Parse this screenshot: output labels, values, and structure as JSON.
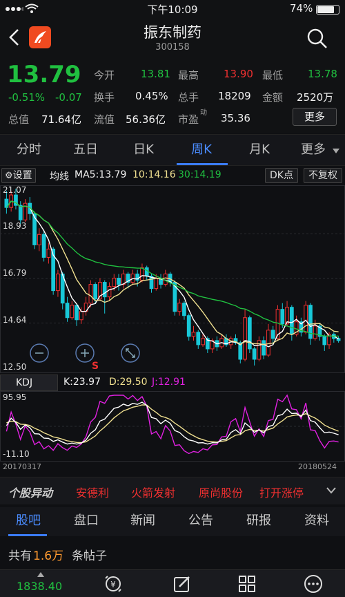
{
  "status_bar": {
    "time": "下午10:09",
    "battery": "74%"
  },
  "header": {
    "title": "振东制药",
    "code": "300158"
  },
  "quote": {
    "price": "13.79",
    "change_pct": "-0.51%",
    "change": "-0.07",
    "open_label": "今开",
    "open": "13.81",
    "high_label": "最高",
    "high": "13.90",
    "low_label": "最低",
    "low": "13.78",
    "turnover_label": "换手",
    "turnover": "0.45%",
    "volume_label": "总手",
    "volume": "18209",
    "amount_label": "金额",
    "amount": "2520万",
    "total_value_label": "总值",
    "total_value": "71.64亿",
    "float_value_label": "流值",
    "float_value": "56.36亿",
    "pe_label": "市盈",
    "pe_sup": "动",
    "pe": "35.36",
    "more": "更多"
  },
  "tabs": [
    "分时",
    "五日",
    "日K",
    "周K",
    "月K",
    "更多"
  ],
  "active_tab": "周K",
  "toolbar": {
    "settings": "设置",
    "ma_label": "均线",
    "ma5": "MA5:13.79",
    "ma10": "10:14.16",
    "ma30": "30:14.19",
    "dk": "DK点",
    "fuquan": "不复权"
  },
  "colors": {
    "up": "#f03030",
    "down": "#18c8d8",
    "ma5": "#ffffff",
    "ma10": "#f0e090",
    "ma30": "#20c040",
    "j": "#e020e0",
    "accent": "#3b7cff"
  },
  "chart_data": {
    "type": "candlestick",
    "y_ticks": [
      "21.07",
      "18.93",
      "16.79",
      "14.64",
      "12.50"
    ],
    "ylim": [
      12.5,
      21.07
    ],
    "x_start": "20170317",
    "x_end": "20180524",
    "candles": [
      [
        20.6,
        20.2,
        21.0,
        19.9
      ],
      [
        20.2,
        20.8,
        21.0,
        20.0
      ],
      [
        20.8,
        20.3,
        21.1,
        20.1
      ],
      [
        20.3,
        19.6,
        20.5,
        19.4
      ],
      [
        19.6,
        20.4,
        20.6,
        19.5
      ],
      [
        20.4,
        19.9,
        20.7,
        19.6
      ],
      [
        19.9,
        18.4,
        20.0,
        18.2
      ],
      [
        18.4,
        18.9,
        19.2,
        18.1
      ],
      [
        18.9,
        17.8,
        19.1,
        17.6
      ],
      [
        17.8,
        18.2,
        18.5,
        17.5
      ],
      [
        18.2,
        16.2,
        18.3,
        16.0
      ],
      [
        16.2,
        17.0,
        17.2,
        15.9
      ],
      [
        17.0,
        15.6,
        17.1,
        15.3
      ],
      [
        15.6,
        14.9,
        15.9,
        14.7
      ],
      [
        14.9,
        15.5,
        15.7,
        14.8
      ],
      [
        15.5,
        14.8,
        15.6,
        14.5
      ],
      [
        14.8,
        15.2,
        15.4,
        14.6
      ],
      [
        15.2,
        15.6,
        15.9,
        15.0
      ],
      [
        15.6,
        16.5,
        16.7,
        15.4
      ],
      [
        16.5,
        15.8,
        16.6,
        15.6
      ],
      [
        15.8,
        16.6,
        16.8,
        15.7
      ],
      [
        16.6,
        15.9,
        16.7,
        15.1
      ],
      [
        15.9,
        16.4,
        16.6,
        15.7
      ],
      [
        16.4,
        16.8,
        17.0,
        16.2
      ],
      [
        16.8,
        16.5,
        17.0,
        16.2
      ],
      [
        16.5,
        17.0,
        17.2,
        16.3
      ],
      [
        17.0,
        16.6,
        17.1,
        16.3
      ],
      [
        16.6,
        17.0,
        17.2,
        16.5
      ],
      [
        17.0,
        16.7,
        17.2,
        16.4
      ],
      [
        16.7,
        17.3,
        17.5,
        16.6
      ],
      [
        17.3,
        16.9,
        17.4,
        16.7
      ],
      [
        16.9,
        16.3,
        17.0,
        16.1
      ],
      [
        16.3,
        16.8,
        17.0,
        16.2
      ],
      [
        16.8,
        16.5,
        17.0,
        16.3
      ],
      [
        16.5,
        17.0,
        17.2,
        16.4
      ],
      [
        17.0,
        16.6,
        17.1,
        16.4
      ],
      [
        16.6,
        15.2,
        16.7,
        15.0
      ],
      [
        15.2,
        15.6,
        15.8,
        15.0
      ],
      [
        15.6,
        15.0,
        15.7,
        14.8
      ],
      [
        15.0,
        14.0,
        15.1,
        13.8
      ],
      [
        14.0,
        14.2,
        14.5,
        13.8
      ],
      [
        14.2,
        13.6,
        14.3,
        13.4
      ],
      [
        13.6,
        13.9,
        14.1,
        13.5
      ],
      [
        13.9,
        13.4,
        14.0,
        13.2
      ],
      [
        13.4,
        13.8,
        13.9,
        13.2
      ],
      [
        13.8,
        13.5,
        14.0,
        13.3
      ],
      [
        13.5,
        13.9,
        14.1,
        13.4
      ],
      [
        13.9,
        13.6,
        14.1,
        13.5
      ],
      [
        13.6,
        13.9,
        14.0,
        13.4
      ],
      [
        13.9,
        13.7,
        14.1,
        13.6
      ],
      [
        13.7,
        12.9,
        13.8,
        12.7
      ],
      [
        12.9,
        14.9,
        15.3,
        12.8
      ],
      [
        14.9,
        13.4,
        15.0,
        13.2
      ],
      [
        13.4,
        12.9,
        13.5,
        12.6
      ],
      [
        12.9,
        13.8,
        14.0,
        12.8
      ],
      [
        13.8,
        13.1,
        14.0,
        12.9
      ],
      [
        13.1,
        14.3,
        14.6,
        13.0
      ],
      [
        14.3,
        13.9,
        14.5,
        13.6
      ],
      [
        13.9,
        15.3,
        15.5,
        13.8
      ],
      [
        15.3,
        14.6,
        15.6,
        14.4
      ],
      [
        14.6,
        15.4,
        15.7,
        14.5
      ],
      [
        15.4,
        14.1,
        15.5,
        13.8
      ],
      [
        14.1,
        14.7,
        15.0,
        14.0
      ],
      [
        14.7,
        14.2,
        14.9,
        14.0
      ],
      [
        14.2,
        15.5,
        15.7,
        14.1
      ],
      [
        15.5,
        13.9,
        15.6,
        13.6
      ],
      [
        13.9,
        14.5,
        14.8,
        13.8
      ],
      [
        14.5,
        14.0,
        14.6,
        13.8
      ],
      [
        14.0,
        13.6,
        14.1,
        13.3
      ],
      [
        13.6,
        14.1,
        14.2,
        13.4
      ],
      [
        14.1,
        13.9,
        14.2,
        13.7
      ],
      [
        13.9,
        13.8,
        14.0,
        13.7
      ]
    ]
  },
  "kdj": {
    "label": "KDJ",
    "k": "K:23.97",
    "d": "D:29.50",
    "j": "J:12.91",
    "y_top": "95.95",
    "y_bottom": "-11.10"
  },
  "ticker": {
    "label": "个股异动",
    "items": [
      "安德利",
      "火箭发射",
      "原尚股份",
      "打开涨停"
    ]
  },
  "subtabs": [
    "股吧",
    "盘口",
    "新闻",
    "公告",
    "研报",
    "资料"
  ],
  "active_subtab": "股吧",
  "posts": {
    "prefix": "共有",
    "count": "1.6万",
    "suffix": "条帖子"
  },
  "bottom": {
    "index_value": "1838.40"
  }
}
